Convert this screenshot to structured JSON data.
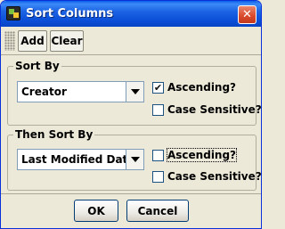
{
  "window": {
    "title": "Sort Columns",
    "close_glyph": "✕",
    "app_icon": "app-icon"
  },
  "toolbar": {
    "add_label": "Add",
    "clear_label": "Clear"
  },
  "sort_by": {
    "legend": "Sort By",
    "selected": "Creator",
    "ascending": {
      "label": "Ascending?",
      "checked": true
    },
    "case_sensitive": {
      "label": "Case Sensitive?",
      "checked": false
    }
  },
  "then_sort_by": {
    "legend": "Then Sort By",
    "selected": "Last Modified Date",
    "ascending": {
      "label": "Ascending?",
      "checked": false
    },
    "case_sensitive": {
      "label": "Case Sensitive?",
      "checked": false
    }
  },
  "buttons": {
    "ok_label": "OK",
    "cancel_label": "Cancel"
  },
  "check_glyph": "✔"
}
